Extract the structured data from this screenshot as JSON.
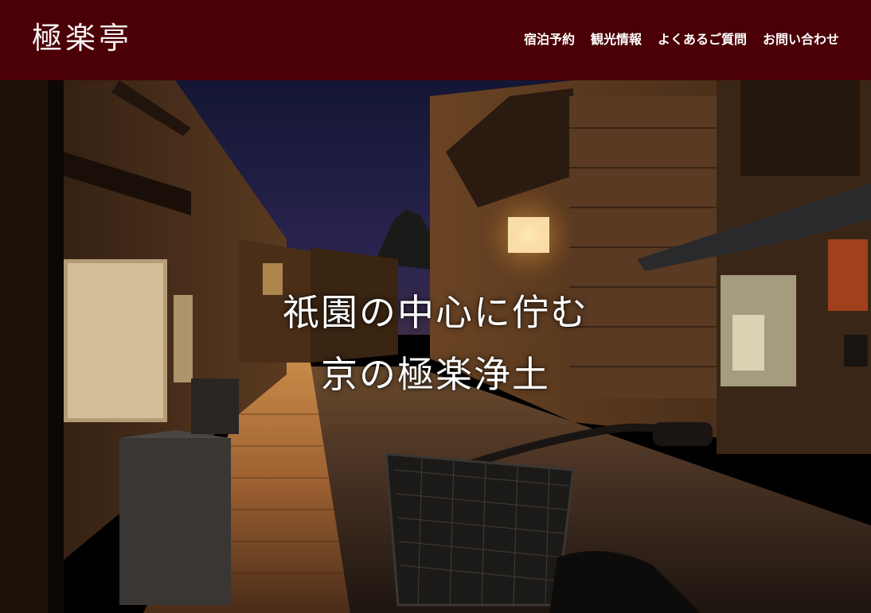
{
  "site": {
    "logo": "極楽亭"
  },
  "nav": {
    "items": [
      {
        "label": "宿泊予約"
      },
      {
        "label": "観光情報"
      },
      {
        "label": "よくあるご質問"
      },
      {
        "label": "お問い合わせ"
      }
    ]
  },
  "hero": {
    "headline_line1": "祇園の中心に佇む",
    "headline_line2": "京の極楽浄土"
  },
  "colors": {
    "header_bg": "#4a0006",
    "text": "#ffffff"
  }
}
